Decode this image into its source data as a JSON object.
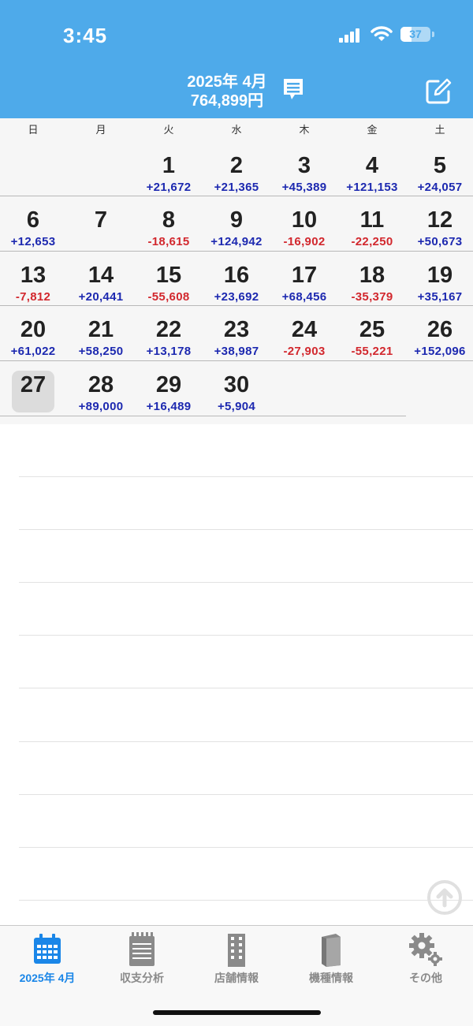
{
  "status_bar": {
    "time": "3:45",
    "battery": "37"
  },
  "header": {
    "month": "2025年 4月",
    "total": "764,899円"
  },
  "weekdays": [
    "日",
    "月",
    "火",
    "水",
    "木",
    "金",
    "土"
  ],
  "calendar": {
    "days": [
      {
        "day": "1",
        "amount": "+21,672"
      },
      {
        "day": "2",
        "amount": "+21,365"
      },
      {
        "day": "3",
        "amount": "+45,389"
      },
      {
        "day": "4",
        "amount": "+121,153"
      },
      {
        "day": "5",
        "amount": "+24,057"
      },
      {
        "day": "6",
        "amount": "+12,653"
      },
      {
        "day": "7",
        "amount": ""
      },
      {
        "day": "8",
        "amount": "-18,615"
      },
      {
        "day": "9",
        "amount": "+124,942"
      },
      {
        "day": "10",
        "amount": "-16,902"
      },
      {
        "day": "11",
        "amount": "-22,250"
      },
      {
        "day": "12",
        "amount": "+50,673"
      },
      {
        "day": "13",
        "amount": "-7,812"
      },
      {
        "day": "14",
        "amount": "+20,441"
      },
      {
        "day": "15",
        "amount": "-55,608"
      },
      {
        "day": "16",
        "amount": "+23,692"
      },
      {
        "day": "17",
        "amount": "+68,456"
      },
      {
        "day": "18",
        "amount": "-35,379"
      },
      {
        "day": "19",
        "amount": "+35,167"
      },
      {
        "day": "20",
        "amount": "+61,022"
      },
      {
        "day": "21",
        "amount": "+58,250"
      },
      {
        "day": "22",
        "amount": "+13,178"
      },
      {
        "day": "23",
        "amount": "+38,987"
      },
      {
        "day": "24",
        "amount": "-27,903"
      },
      {
        "day": "25",
        "amount": "-55,221"
      },
      {
        "day": "26",
        "amount": "+152,096"
      },
      {
        "day": "27",
        "amount": ""
      },
      {
        "day": "28",
        "amount": "+89,000"
      },
      {
        "day": "29",
        "amount": "+16,489"
      },
      {
        "day": "30",
        "amount": "+5,904"
      }
    ],
    "today": "27"
  },
  "colors": {
    "header": "#4eaaea",
    "positive": "#1d29b0",
    "negative": "#d2282e",
    "active_tab": "#1a86e8"
  },
  "tabs": [
    {
      "label": "2025年 4月",
      "icon": "calendar-icon",
      "active": true
    },
    {
      "label": "収支分析",
      "icon": "notepad-icon",
      "active": false
    },
    {
      "label": "店舗情報",
      "icon": "building-icon",
      "active": false
    },
    {
      "label": "機種情報",
      "icon": "book-icon",
      "active": false
    },
    {
      "label": "その他",
      "icon": "gear-icon",
      "active": false
    }
  ]
}
